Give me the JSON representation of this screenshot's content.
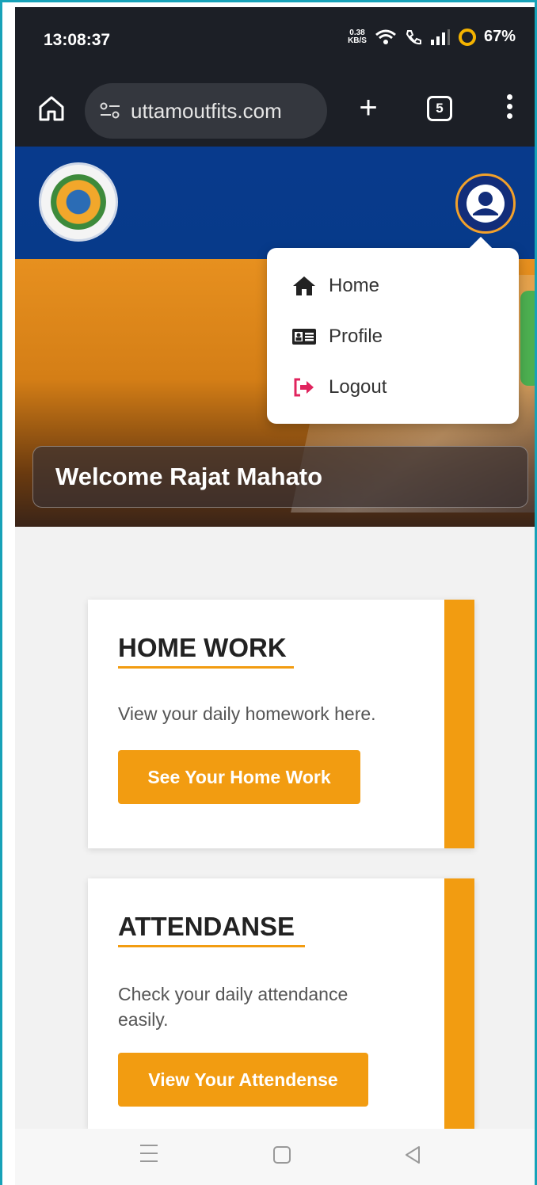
{
  "status_bar": {
    "time": "13:08:37",
    "net_speed_value": "0.38",
    "net_speed_unit": "KB/S",
    "battery": "67%",
    "icons": [
      "wifi-icon",
      "call-icon",
      "signal-icon",
      "battery-ring-icon"
    ]
  },
  "browser": {
    "url": "uttamoutfits.com",
    "tab_count": "5",
    "icons": [
      "home-icon",
      "site-info-icon",
      "new-tab-icon",
      "menu-dots-icon"
    ]
  },
  "header": {
    "logo_icon": "school-logo",
    "avatar_icon": "user-avatar-icon"
  },
  "dropdown": {
    "items": [
      {
        "label": "Home",
        "icon": "home-icon"
      },
      {
        "label": "Profile",
        "icon": "id-card-icon"
      },
      {
        "label": "Logout",
        "icon": "logout-icon"
      }
    ],
    "logout_color": "#e0245e"
  },
  "hero": {
    "welcome": "Welcome Rajat Mahato"
  },
  "cards": [
    {
      "title": "HOME WORK",
      "description": "View your daily homework here.",
      "button": "See Your Home Work"
    },
    {
      "title": "ATTENDANSE",
      "description": "Check your daily attendance easily.",
      "button": "View Your Attendense"
    }
  ],
  "colors": {
    "accent": "#f29c11",
    "header_blue": "#083a8c",
    "frame": "#17a2b8"
  }
}
